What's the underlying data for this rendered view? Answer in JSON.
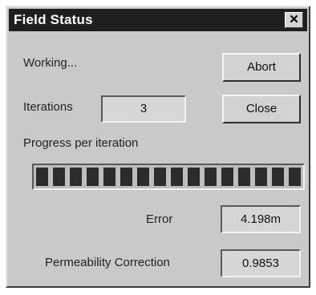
{
  "window": {
    "title": "Field Status",
    "close_glyph": "✕"
  },
  "status": {
    "text": "Working..."
  },
  "buttons": {
    "abort_label": "Abort",
    "close_label": "Close"
  },
  "iterations": {
    "label": "Iterations",
    "value": "3"
  },
  "progress": {
    "label": "Progress per iteration",
    "fraction": 0.96,
    "segments": 16
  },
  "error": {
    "label": "Error",
    "value": "4.198m"
  },
  "permeability": {
    "label": "Permeability Correction",
    "value": "0.9853"
  },
  "colors": {
    "titlebar": "#1f1f1f",
    "dialog_bg": "#c9c9c9",
    "progress_segment": "#2c2c2c"
  }
}
